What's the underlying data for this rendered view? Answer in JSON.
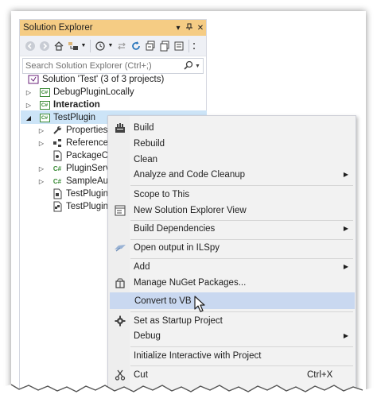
{
  "panel": {
    "title": "Solution Explorer",
    "title_pin": "▾",
    "title_autohide": "⊥",
    "title_close": "✕",
    "search_placeholder": "Search Solution Explorer (Ctrl+;)"
  },
  "toolbar": {
    "buttons": [
      "back-icon",
      "forward-icon",
      "home-icon",
      "switch-views-icon",
      "pending-changes-icon",
      "sync-icon",
      "refresh-icon",
      "collapse-all-icon",
      "show-all-files-icon",
      "properties-icon"
    ]
  },
  "tree": {
    "solution": "Solution 'Test' (3 of 3 projects)",
    "projects": [
      "DebugPluginLocally",
      "Interaction",
      "TestPlugin"
    ],
    "children": [
      "Properties",
      "References",
      "PackageCo",
      "PluginServ",
      "SampleAut",
      "TestPlugin.",
      "TestPlugin."
    ]
  },
  "menu": {
    "build": "Build",
    "rebuild": "Rebuild",
    "clean": "Clean",
    "analyze": "Analyze and Code Cleanup",
    "scope": "Scope to This",
    "new_view": "New Solution Explorer View",
    "build_deps": "Build Dependencies",
    "open_ilspy": "Open output in ILSpy",
    "add": "Add",
    "manage_nuget": "Manage NuGet Packages...",
    "convert_vb": "Convert to VB",
    "startup": "Set as Startup Project",
    "debug": "Debug",
    "interactive": "Initialize Interactive with Project",
    "cut": "Cut",
    "cut_key": "Ctrl+X",
    "submenu_arrow": "▶"
  },
  "colors": {
    "title_bar": "#f5cc84",
    "selection": "#cce4f7",
    "menu_highlight": "#c9d8f0",
    "csharp_green": "#388a34"
  }
}
